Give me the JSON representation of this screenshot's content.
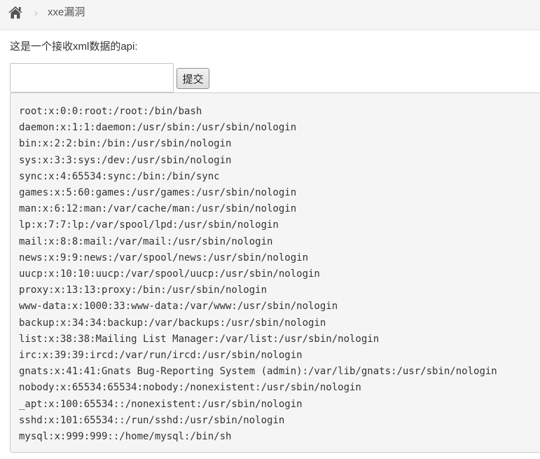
{
  "breadcrumb": {
    "home_icon": "home-icon",
    "separator": "›",
    "current": "xxe漏洞"
  },
  "intro_text": "这是一个接收xml数据的api:",
  "form": {
    "input_value": "",
    "input_placeholder": "",
    "submit_label": "提交"
  },
  "output_lines": [
    "root:x:0:0:root:/root:/bin/bash",
    "daemon:x:1:1:daemon:/usr/sbin:/usr/sbin/nologin",
    "bin:x:2:2:bin:/bin:/usr/sbin/nologin",
    "sys:x:3:3:sys:/dev:/usr/sbin/nologin",
    "sync:x:4:65534:sync:/bin:/bin/sync",
    "games:x:5:60:games:/usr/games:/usr/sbin/nologin",
    "man:x:6:12:man:/var/cache/man:/usr/sbin/nologin",
    "lp:x:7:7:lp:/var/spool/lpd:/usr/sbin/nologin",
    "mail:x:8:8:mail:/var/mail:/usr/sbin/nologin",
    "news:x:9:9:news:/var/spool/news:/usr/sbin/nologin",
    "uucp:x:10:10:uucp:/var/spool/uucp:/usr/sbin/nologin",
    "proxy:x:13:13:proxy:/bin:/usr/sbin/nologin",
    "www-data:x:1000:33:www-data:/var/www:/usr/sbin/nologin",
    "backup:x:34:34:backup:/var/backups:/usr/sbin/nologin",
    "list:x:38:38:Mailing List Manager:/var/list:/usr/sbin/nologin",
    "irc:x:39:39:ircd:/var/run/ircd:/usr/sbin/nologin",
    "gnats:x:41:41:Gnats Bug-Reporting System (admin):/var/lib/gnats:/usr/sbin/nologin",
    "nobody:x:65534:65534:nobody:/nonexistent:/usr/sbin/nologin",
    "_apt:x:100:65534::/nonexistent:/usr/sbin/nologin",
    "sshd:x:101:65534::/run/sshd:/usr/sbin/nologin",
    "mysql:x:999:999::/home/mysql:/bin/sh"
  ]
}
